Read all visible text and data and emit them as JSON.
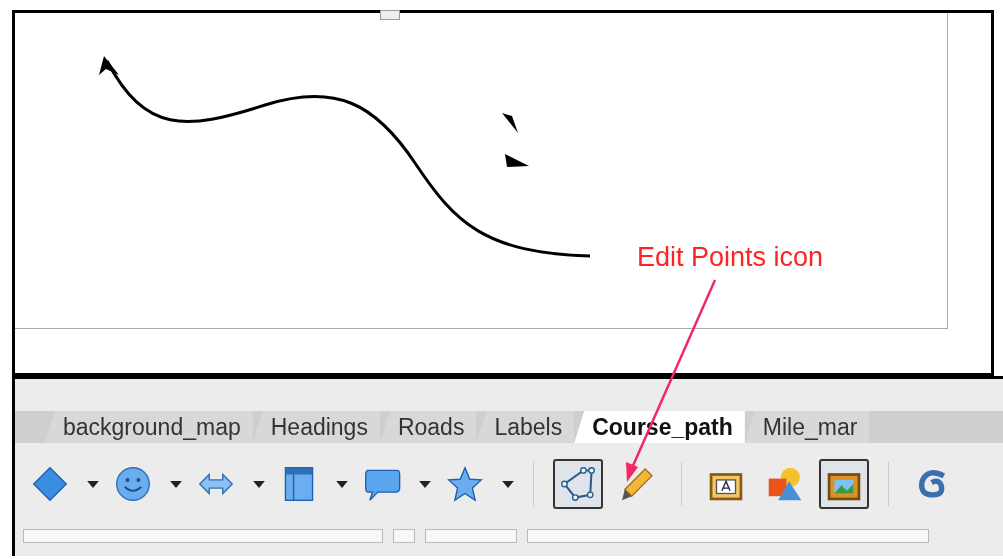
{
  "annotation": {
    "text": "Edit Points icon"
  },
  "tabs": [
    {
      "label": "background_map",
      "selected": false
    },
    {
      "label": "Headings",
      "selected": false
    },
    {
      "label": "Roads",
      "selected": false
    },
    {
      "label": "Labels",
      "selected": false
    },
    {
      "label": "Course_path",
      "selected": true
    },
    {
      "label": "Mile_mar",
      "selected": false
    }
  ],
  "toolbar": [
    {
      "kind": "diamond",
      "menu": true,
      "pressed": false
    },
    {
      "kind": "smiley",
      "menu": true,
      "pressed": false
    },
    {
      "kind": "double-arrow",
      "menu": true,
      "pressed": false
    },
    {
      "kind": "panel",
      "menu": true,
      "pressed": false
    },
    {
      "kind": "speech",
      "menu": true,
      "pressed": false
    },
    {
      "kind": "star",
      "menu": true,
      "pressed": false
    },
    {
      "kind": "sep"
    },
    {
      "kind": "edit-points",
      "menu": false,
      "pressed": true
    },
    {
      "kind": "pencil",
      "menu": false,
      "pressed": false
    },
    {
      "kind": "sep"
    },
    {
      "kind": "text-frame",
      "menu": false,
      "pressed": false
    },
    {
      "kind": "shapes",
      "menu": false,
      "pressed": false
    },
    {
      "kind": "picture-frame",
      "menu": false,
      "pressed": true
    },
    {
      "kind": "sep"
    },
    {
      "kind": "swirl",
      "menu": false,
      "pressed": false
    }
  ]
}
